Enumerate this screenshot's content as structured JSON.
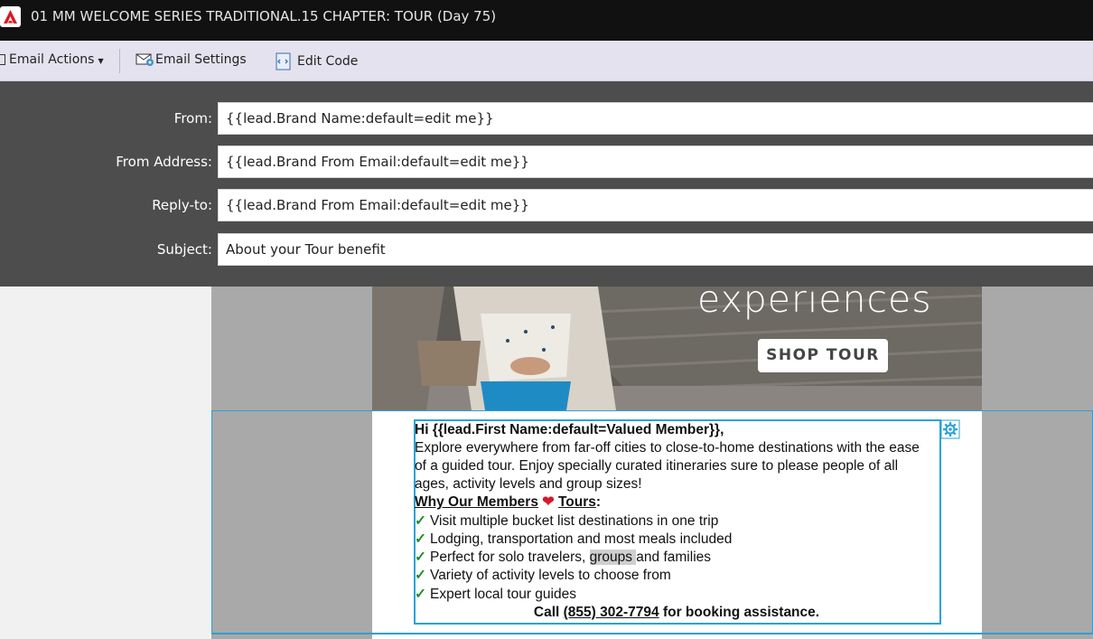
{
  "window": {
    "title": "01 MM WELCOME SERIES TRADITIONAL.15 CHAPTER: TOUR (Day 75)",
    "app_icon": "adobe-icon"
  },
  "toolbar": {
    "email_actions": "Email Actions",
    "email_settings": "Email Settings",
    "edit_code": "Edit Code"
  },
  "header_fields": {
    "from_label": "From:",
    "from_value": "{{lead.Brand Name:default=edit me}}",
    "from_address_label": "From Address:",
    "from_address_value": "{{lead.Brand From Email:default=edit me}}",
    "reply_to_label": "Reply-to:",
    "reply_to_value": "{{lead.Brand From Email:default=edit me}}",
    "subject_label": "Subject:",
    "subject_value": "About your Tour benefit"
  },
  "hero": {
    "headline": "experiences",
    "button": "SHOP TOUR"
  },
  "body": {
    "greeting": "Hi {{lead.First Name:default=Valued Member}},",
    "para_line1": "Explore everywhere from far-off cities to close-to-home destinations with the ease",
    "para_line2": "of a guided tour. Enjoy specially curated itineraries sure to please people of all",
    "para_line3": "ages, activity levels and group sizes!",
    "why_prefix": "Why Our Members",
    "heart": "❤",
    "why_suffix": "Tours",
    "why_colon": ":",
    "check": "✓",
    "bullet1": "Visit multiple bucket list destinations in one trip",
    "bullet2": "Lodging, transportation and most meals included",
    "bullet3_a": "Perfect for solo travelers, ",
    "bullet3_hl": "groups ",
    "bullet3_b": "and families",
    "bullet4": "Variety of activity levels to choose from",
    "bullet5": "Expert local tour guides",
    "call_prefix": "Call ",
    "phone": "(855) 302-7794",
    "call_suffix": " for booking assistance."
  },
  "icons": {
    "gear": "gear-icon",
    "email_settings": "envelope-gear-icon",
    "edit_code": "code-file-icon"
  },
  "colors": {
    "title_bar": "#111111",
    "toolbar": "#e4e2ee",
    "header_panel": "#4d4d4d",
    "selection": "#2aa3d6",
    "check": "#1e8e1e",
    "heart": "#d6182b"
  }
}
